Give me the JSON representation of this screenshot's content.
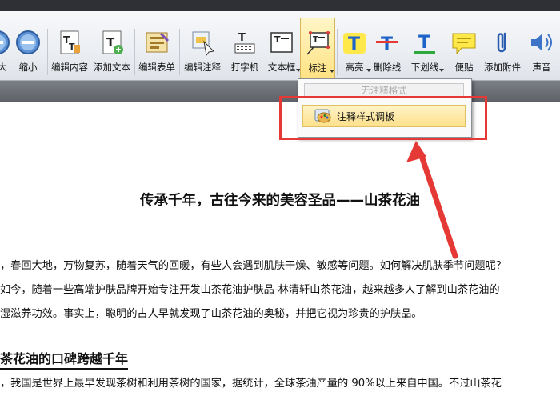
{
  "toolbar": {
    "buttons": [
      {
        "label": "大",
        "icon": "zoom-in-icon"
      },
      {
        "label": "缩小",
        "icon": "zoom-out-icon"
      },
      {
        "label": "编辑内容",
        "icon": "edit-content-icon"
      },
      {
        "label": "添加文本",
        "icon": "add-text-icon"
      },
      {
        "label": "编辑表单",
        "icon": "edit-form-icon"
      },
      {
        "label": "编辑注释",
        "icon": "edit-annotation-icon"
      },
      {
        "label": "打字机",
        "icon": "typewriter-icon"
      },
      {
        "label": "文本框",
        "icon": "textbox-icon"
      },
      {
        "label": "标注",
        "icon": "callout-icon"
      },
      {
        "label": "高亮",
        "icon": "highlight-icon"
      },
      {
        "label": "删除线",
        "icon": "strikethrough-icon"
      },
      {
        "label": "下划线",
        "icon": "underline-icon"
      },
      {
        "label": "便贴",
        "icon": "sticky-note-icon"
      },
      {
        "label": "添加附件",
        "icon": "attachment-icon"
      },
      {
        "label": "声音",
        "icon": "sound-icon"
      }
    ]
  },
  "dropdown": {
    "header": "无注释格式",
    "item": "注释样式调板"
  },
  "document": {
    "title": "传承千年，古往今来的美容圣品——山茶花油",
    "paragraph1": [
      "，春回大地，万物复苏，随着天气的回暖，有些人会遇到肌肤干燥、敏感等问题。如何解决肌肤季节问题呢？",
      "如今，随着一些高端护肤品牌开始专注开发山茶花油护肤品-林清轩山茶花油，越来越多人了解到山茶花油的",
      "湿滋养功效。事实上，聪明的古人早就发现了山茶花油的奥秘，并把它视为珍贵的护肤品。"
    ],
    "heading2": "茶花油的口碑跨越千年",
    "paragraph2": [
      "，我国是世界上最早发现茶树和利用茶树的国家，据统计，全球茶油产量的 90%以上来自中国。不过山茶花"
    ]
  },
  "colors": {
    "accent_red": "#e53935",
    "active_yellow": "#ffe284",
    "dark_bar": "#2e3036"
  }
}
